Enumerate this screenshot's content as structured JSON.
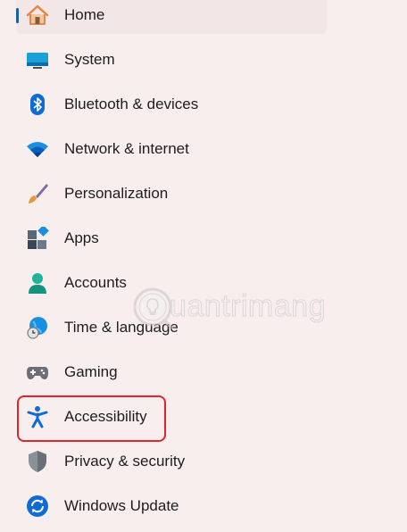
{
  "nav": {
    "items": [
      {
        "label": "Home",
        "icon": "home-icon",
        "selected": true
      },
      {
        "label": "System",
        "icon": "system-display-icon"
      },
      {
        "label": "Bluetooth & devices",
        "icon": "bluetooth-icon"
      },
      {
        "label": "Network & internet",
        "icon": "wifi-icon"
      },
      {
        "label": "Personalization",
        "icon": "paintbrush-icon"
      },
      {
        "label": "Apps",
        "icon": "apps-icon"
      },
      {
        "label": "Accounts",
        "icon": "person-icon"
      },
      {
        "label": "Time & language",
        "icon": "globe-clock-icon"
      },
      {
        "label": "Gaming",
        "icon": "gamepad-icon"
      },
      {
        "label": "Accessibility",
        "icon": "accessibility-icon"
      },
      {
        "label": "Privacy & security",
        "icon": "shield-icon"
      },
      {
        "label": "Windows Update",
        "icon": "update-icon"
      }
    ]
  },
  "watermark": {
    "text": "uantrimang"
  },
  "colors": {
    "selection_indicator": "#1f5ea8",
    "highlight_box": "#e0242c"
  }
}
